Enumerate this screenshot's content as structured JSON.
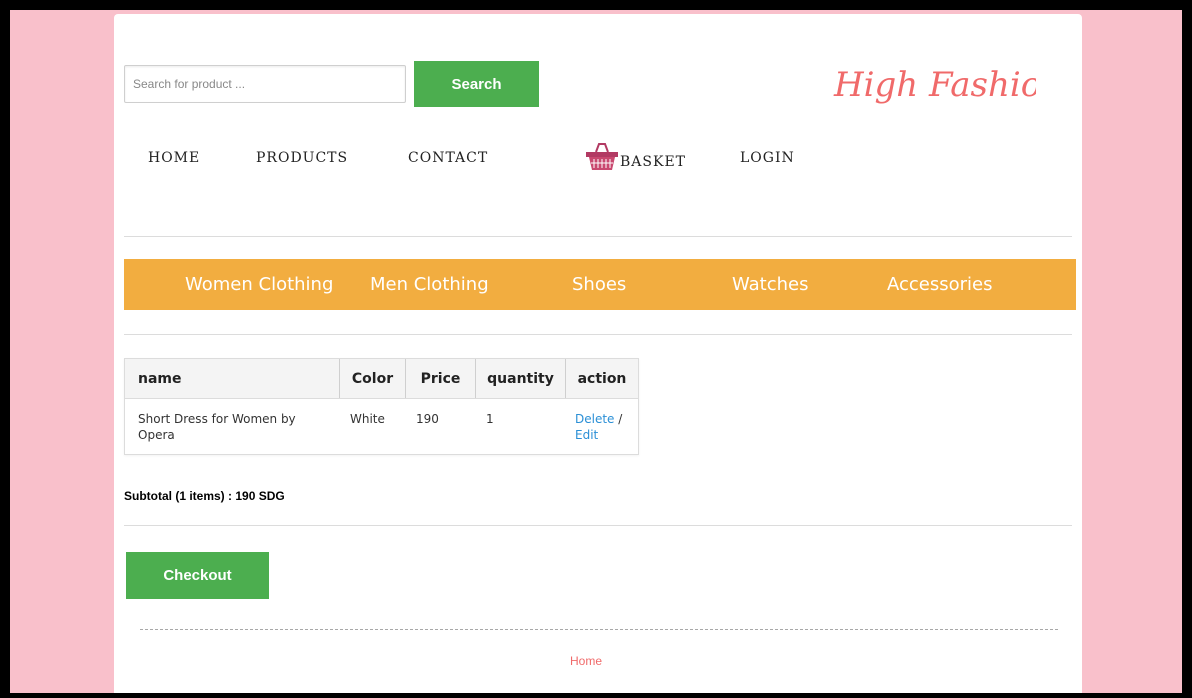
{
  "search": {
    "placeholder": "Search for product ...",
    "button_label": "Search"
  },
  "logo": {
    "text": "High Fashion"
  },
  "nav": {
    "home": "HOME",
    "products": "PRODUCTS",
    "contact": "CONTACT",
    "basket": "BASKET",
    "login": "LOGIN"
  },
  "categories": [
    "Women Clothing",
    "Men Clothing",
    "Shoes",
    "Watches",
    "Accessories"
  ],
  "cart": {
    "headers": [
      "name",
      "Color",
      "Price",
      "quantity",
      "action"
    ],
    "rows": [
      {
        "name": "Short Dress for Women by Opera",
        "color": "White",
        "price": "190",
        "quantity": "1",
        "delete": "Delete",
        "separator": " /",
        "edit": "Edit"
      }
    ]
  },
  "subtotal": "Subtotal (1 items) : 190 SDG",
  "checkout_label": "Checkout",
  "footer": {
    "home_link": "Home"
  },
  "colors": {
    "background": "#f9c0cb",
    "accent_green": "#4cae4f",
    "category_bar": "#f2ad40",
    "logo": "#f06a6a",
    "link": "#2a8fd6"
  }
}
